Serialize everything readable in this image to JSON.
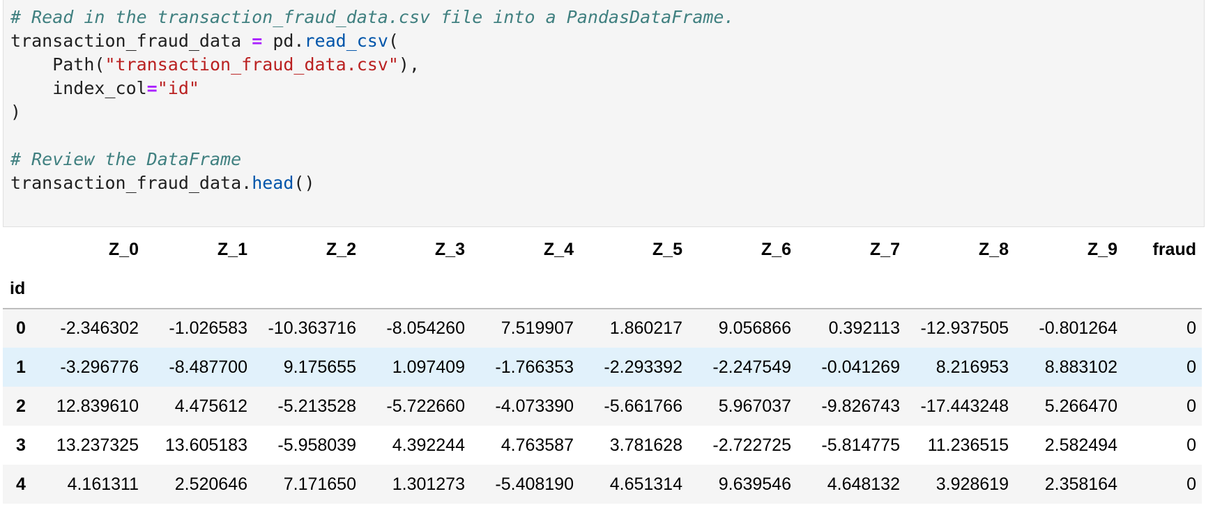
{
  "code": {
    "line1": "# Read in the transaction_fraud_data.csv file into a PandasDataFrame.",
    "line2_var": "transaction_fraud_data",
    "line2_eq": "=",
    "line2_obj": " pd.",
    "line2_fn": "read_csv",
    "line2_paren": "(",
    "line3_pre": "    Path(",
    "line3_str": "\"transaction_fraud_data.csv\"",
    "line3_post": "),",
    "line4_pre": "    index_col",
    "line4_eq": "=",
    "line4_str": "\"id\"",
    "line5": ")",
    "line7": "# Review the DataFrame",
    "line8_obj": "transaction_fraud_data.",
    "line8_fn": "head",
    "line8_paren": "()"
  },
  "table": {
    "columns": [
      "Z_0",
      "Z_1",
      "Z_2",
      "Z_3",
      "Z_4",
      "Z_5",
      "Z_6",
      "Z_7",
      "Z_8",
      "Z_9",
      "fraud"
    ],
    "index_name": "id",
    "rows": [
      {
        "id": "0",
        "values": [
          "-2.346302",
          "-1.026583",
          "-10.363716",
          "-8.054260",
          "7.519907",
          "1.860217",
          "9.056866",
          "0.392113",
          "-12.937505",
          "-0.801264",
          "0"
        ]
      },
      {
        "id": "1",
        "values": [
          "-3.296776",
          "-8.487700",
          "9.175655",
          "1.097409",
          "-1.766353",
          "-2.293392",
          "-2.247549",
          "-0.041269",
          "8.216953",
          "8.883102",
          "0"
        ]
      },
      {
        "id": "2",
        "values": [
          "12.839610",
          "4.475612",
          "-5.213528",
          "-5.722660",
          "-4.073390",
          "-5.661766",
          "5.967037",
          "-9.826743",
          "-17.443248",
          "5.266470",
          "0"
        ]
      },
      {
        "id": "3",
        "values": [
          "13.237325",
          "13.605183",
          "-5.958039",
          "4.392244",
          "4.763587",
          "3.781628",
          "-2.722725",
          "-5.814775",
          "11.236515",
          "2.582494",
          "0"
        ]
      },
      {
        "id": "4",
        "values": [
          "4.161311",
          "2.520646",
          "7.171650",
          "1.301273",
          "-5.408190",
          "4.651314",
          "9.639546",
          "4.648132",
          "3.928619",
          "2.358164",
          "0"
        ]
      }
    ]
  }
}
